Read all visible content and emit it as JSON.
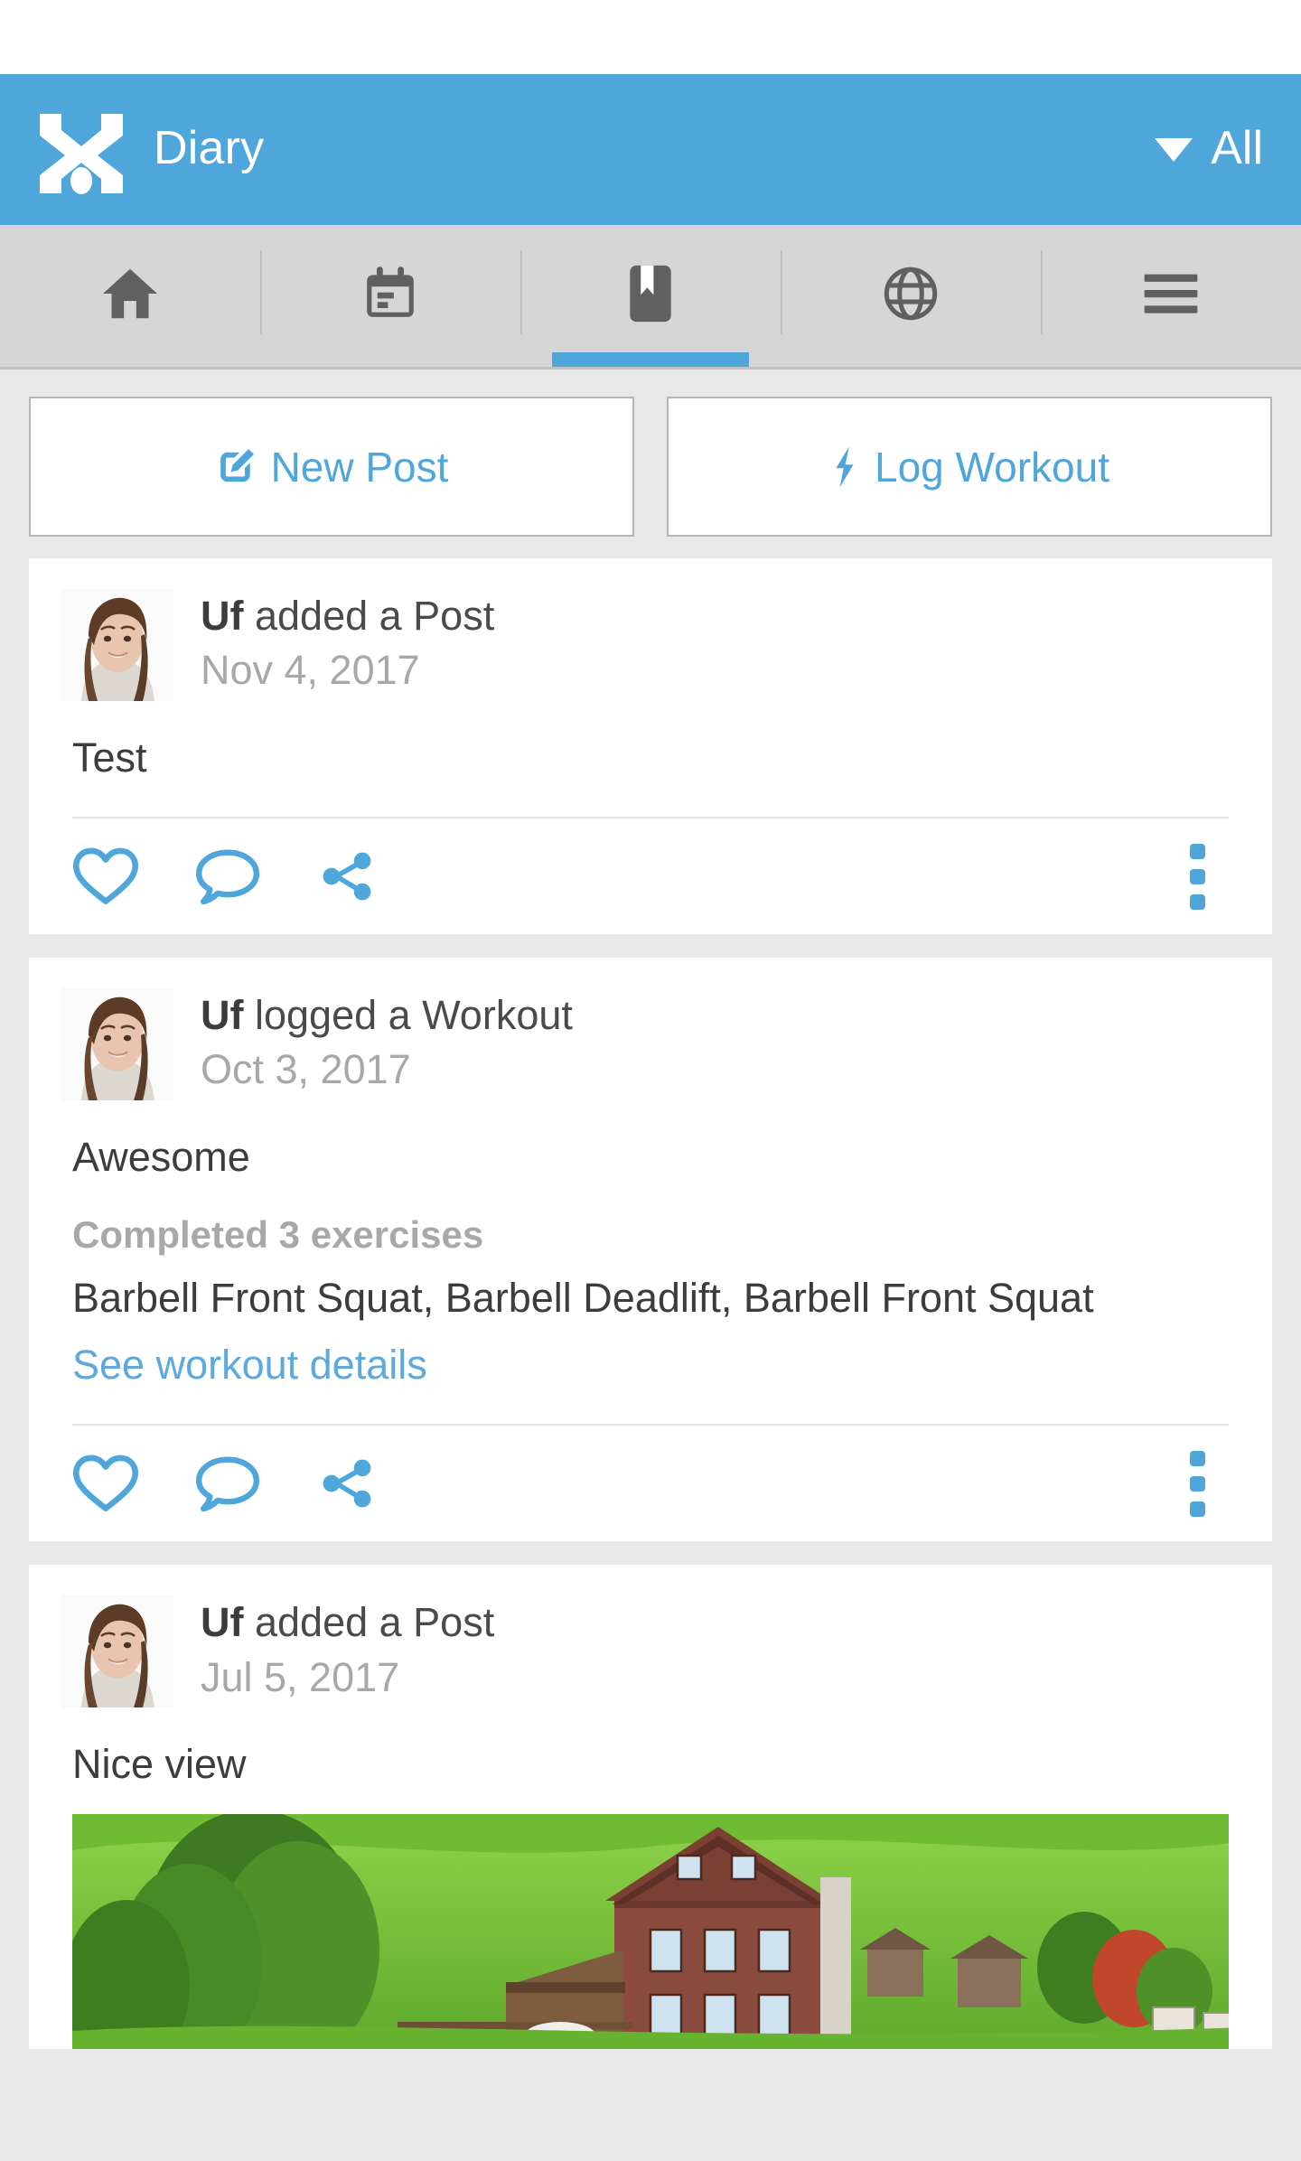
{
  "appbar": {
    "logo_icon": "x-logo-icon",
    "title": "Diary",
    "filter_caret_icon": "caret-down-icon",
    "filter_label": "All"
  },
  "tabs": [
    {
      "name": "home",
      "icon": "home-icon",
      "active": false
    },
    {
      "name": "calendar",
      "icon": "calendar-icon",
      "active": false
    },
    {
      "name": "diary",
      "icon": "bookmark-icon",
      "active": true
    },
    {
      "name": "explore",
      "icon": "globe-icon",
      "active": false
    },
    {
      "name": "menu",
      "icon": "hamburger-icon",
      "active": false
    }
  ],
  "actions": {
    "new_post": {
      "label": "New Post",
      "icon": "edit-pencil-icon"
    },
    "log_workout": {
      "label": "Log Workout",
      "icon": "lightning-bolt-icon"
    }
  },
  "feed": [
    {
      "user": "Uf",
      "action": " added a Post",
      "date": "Nov 4, 2017",
      "body": "Test",
      "avatar_icon": "user-avatar-photo",
      "like_icon": "heart-icon",
      "comment_icon": "comment-bubble-icon",
      "share_icon": "share-icon",
      "overflow_icon": "more-vertical-icon"
    },
    {
      "user": "Uf",
      "action": " logged a Workout",
      "date": "Oct 3, 2017",
      "body": "Awesome",
      "summary": "Completed 3 exercises",
      "exercises": "Barbell Front Squat, Barbell Deadlift, Barbell Front Squat",
      "details_link": "See workout details",
      "avatar_icon": "user-avatar-photo",
      "like_icon": "heart-icon",
      "comment_icon": "comment-bubble-icon",
      "share_icon": "share-icon",
      "overflow_icon": "more-vertical-icon"
    },
    {
      "user": "Uf",
      "action": " added a Post",
      "date": "Jul 5, 2017",
      "body": "Nice view",
      "photo_icon": "landscape-chalet-photo",
      "avatar_icon": "user-avatar-photo"
    }
  ],
  "colors": {
    "accent": "#4FA6DB",
    "link": "#5BA9DE",
    "appbar": "#4FA6DB",
    "tabbar": "#d6d6d6",
    "page_bg": "#e8e8e8",
    "card_bg": "#ffffff",
    "text": "#3c3c3c",
    "muted": "#a8a8a8"
  }
}
